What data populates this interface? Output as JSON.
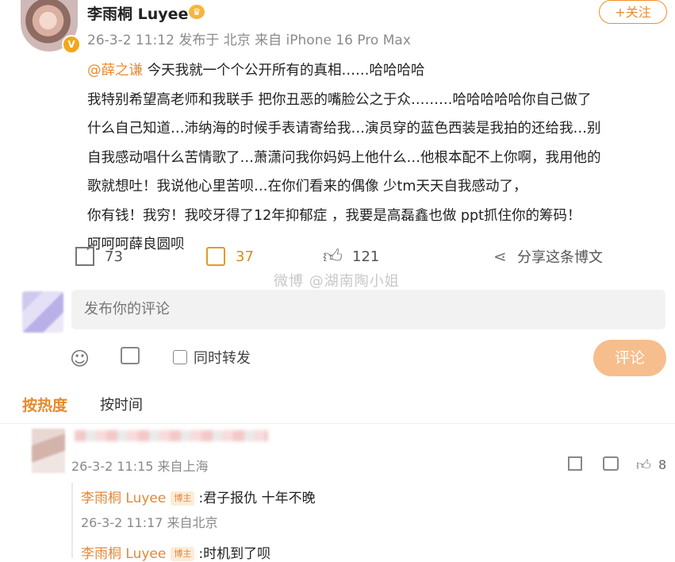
{
  "header": {
    "username": "李雨桐 Luyee",
    "meta": "26-3-2 11:12 发布于 北京 来自 iPhone 16 Pro Max",
    "follow_label": "+关注"
  },
  "post": {
    "mention": "@薛之谦",
    "lines": [
      " 今天我就一个个公开所有的真相……哈哈哈哈",
      "我特别希望高老师和我联手 把你丑恶的嘴脸公之于众………哈哈哈哈哈你自己做了",
      "什么自己知道…沛纳海的时候手表请寄给我…演员穿的蓝色西装是我拍的还给我…别",
      "自我感动唱什么苦情歌了…萧潇问我你妈妈上他什么…他根本配不上你啊，我用他的",
      "歌就想吐！我说他心里苦呗…在你们看来的偶像 少tm天天自我感动了，",
      "你有钱！我穷！我咬牙得了12年抑郁症 ，我要是高磊鑫也做 ppt抓住你的筹码！",
      "呵呵呵薛良圆呗"
    ]
  },
  "actions": {
    "forward_count": "73",
    "comment_count": "37",
    "like_count": "121",
    "share_label": "分享这条博文"
  },
  "watermark": "微博 @湖南陶小姐",
  "comment_box": {
    "placeholder": "发布你的评论",
    "forward_label": "同时转发",
    "submit_label": "评论"
  },
  "sort_tabs": {
    "hot": "按热度",
    "time": "按时间"
  },
  "comments": [
    {
      "meta": "26-3-2 11:15 来自上海",
      "like_count": "8",
      "replies": [
        {
          "author": "李雨桐 Luyee",
          "badge": "博主",
          "text": ":君子报仇 十年不晚",
          "meta": "26-3-2 11:17 来自北京"
        },
        {
          "author": "李雨桐 Luyee",
          "badge": "博主",
          "text": ":时机到了呗"
        }
      ]
    }
  ],
  "colors": {
    "accent": "#f08a2a",
    "submit_bg": "#f6be8c",
    "input_bg": "#f2f2f2"
  },
  "icons": [
    "forward-icon",
    "comment-icon",
    "like-icon",
    "share-icon",
    "emoji-icon",
    "image-icon",
    "crown-icon",
    "verified-icon"
  ]
}
